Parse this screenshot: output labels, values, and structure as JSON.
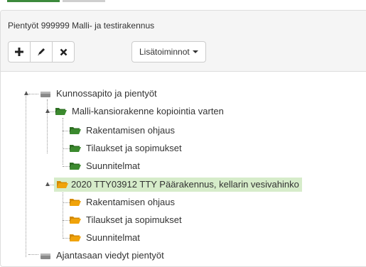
{
  "panel": {
    "title": "Pientyöt 999999 Malli- ja testirakennus"
  },
  "toolbar": {
    "add_icon": "plus-icon",
    "edit_icon": "pencil-icon",
    "delete_icon": "x-icon",
    "more_label": "Lisätoiminnot"
  },
  "tree": {
    "root": {
      "label": "Kunnossapito ja pientyöt",
      "icon": "drive-icon"
    },
    "folder1": {
      "label": "Malli-kansiorakenne kopiointia varten",
      "icon": "folder-open-icon",
      "children": [
        "Rakentamisen ohjaus",
        "Tilaukset ja sopimukset",
        "Suunnitelmat"
      ]
    },
    "folder2": {
      "label": "2020 TTY03912 TTY Päärakennus, kellarin vesivahinko",
      "icon": "folder-open-icon",
      "children": [
        "Rakentamisen ohjaus",
        "Tilaukset ja sopimukset",
        "Suunnitelmat"
      ]
    },
    "next_root": {
      "label": "Ajantasaan viedyt pientyöt",
      "icon": "drive-icon"
    }
  },
  "colors": {
    "green_folder": "#3b8a2e",
    "orange_folder": "#f0a30a",
    "selected_bg": "#d6ecca",
    "tab_active": "#3c8a3c"
  }
}
